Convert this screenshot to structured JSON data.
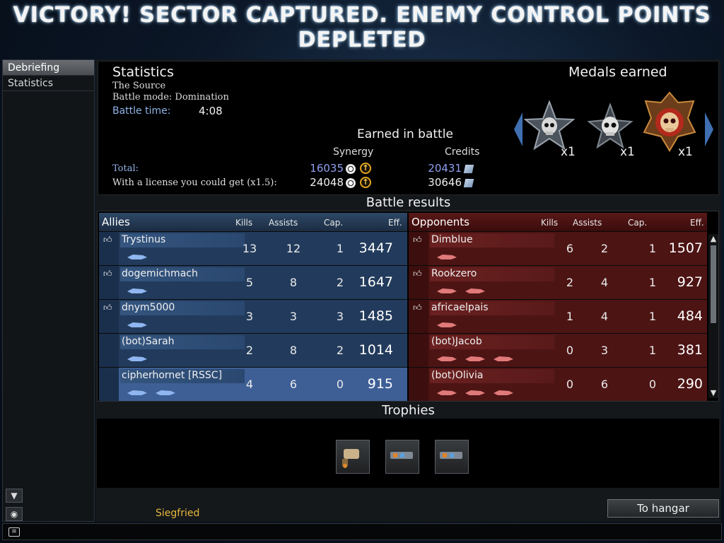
{
  "banner": "VICTORY! SECTOR CAPTURED. ENEMY CONTROL POINTS DEPLETED",
  "sidebar": {
    "items": [
      {
        "label": "Debriefing",
        "active": true
      },
      {
        "label": "Statistics",
        "active": false
      }
    ]
  },
  "stats": {
    "title": "Statistics",
    "map": "The Source",
    "mode": "Battle mode: Domination",
    "battle_time_label": "Battle time:",
    "battle_time": "4:08"
  },
  "earned": {
    "title": "Earned in battle",
    "synergy_header": "Synergy",
    "credits_header": "Credits",
    "total_label": "Total:",
    "total_synergy": "16035",
    "total_credits": "20431",
    "license_label": "With a license you could get (x1.5):",
    "license_synergy": "24048",
    "license_credits": "30646"
  },
  "medals": {
    "title": "Medals earned",
    "items": [
      {
        "icon": "skull-star-medal-icon",
        "count": "x1"
      },
      {
        "icon": "skull-medal-icon",
        "count": "x1"
      },
      {
        "icon": "demon-skull-medal-icon",
        "count": "x1"
      }
    ]
  },
  "results": {
    "title": "Battle results",
    "headers": {
      "kills": "Kills",
      "assists": "Assists",
      "cap": "Cap.",
      "eff": "Eff."
    },
    "allies": {
      "label": "Allies",
      "rows": [
        {
          "name": "Trystinus",
          "kills": "13",
          "assists": "12",
          "cap": "1",
          "eff": "3447"
        },
        {
          "name": "dogemichmach",
          "kills": "5",
          "assists": "8",
          "cap": "2",
          "eff": "1647"
        },
        {
          "name": "dnym5000",
          "kills": "3",
          "assists": "3",
          "cap": "3",
          "eff": "1485"
        },
        {
          "name": "(bot)Sarah",
          "kills": "2",
          "assists": "8",
          "cap": "2",
          "eff": "1014"
        },
        {
          "name": "cipherhornet [RSSC]",
          "kills": "4",
          "assists": "6",
          "cap": "0",
          "eff": "915"
        }
      ]
    },
    "opponents": {
      "label": "Opponents",
      "rows": [
        {
          "name": "Dimblue",
          "kills": "6",
          "assists": "2",
          "cap": "1",
          "eff": "1507"
        },
        {
          "name": "Rookzero",
          "kills": "2",
          "assists": "4",
          "cap": "1",
          "eff": "927"
        },
        {
          "name": "africaelpais",
          "kills": "1",
          "assists": "4",
          "cap": "1",
          "eff": "484"
        },
        {
          "name": "(bot)Jacob",
          "kills": "0",
          "assists": "3",
          "cap": "1",
          "eff": "381"
        },
        {
          "name": "(bot)Olivia",
          "kills": "0",
          "assists": "6",
          "cap": "0",
          "eff": "290"
        }
      ]
    }
  },
  "trophies": {
    "title": "Trophies"
  },
  "footer": {
    "player_name": "Siegfried",
    "to_hangar": "To hangar"
  },
  "colors": {
    "ally_row": "#223b5c",
    "ally_row_self": "#3e5f96",
    "opponent_row": "#4d1414",
    "synergy_value": "#8f9ff0",
    "player_name": "#e6b83a"
  }
}
